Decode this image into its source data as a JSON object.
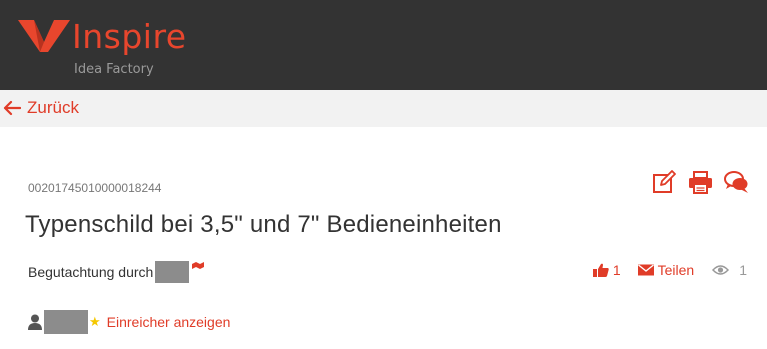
{
  "header": {
    "brand": "Inspire",
    "tagline": "Idea Factory",
    "logo_icon": "v-logo-icon",
    "background": "#333333",
    "accent": "#e8462d"
  },
  "nav": {
    "back_label": "Zurück",
    "back_icon": "arrow-left-icon"
  },
  "idea": {
    "number": "00201745010000018244",
    "title": "Typenschild bei 3,5\" und 7\" Bedieneinheiten",
    "review_label": "Begutachtung durch"
  },
  "toolbar": {
    "icons": [
      "edit-icon",
      "print-icon",
      "comments-icon"
    ]
  },
  "stats": {
    "likes": "1",
    "share_label": "Teilen",
    "views": "1"
  },
  "submitter": {
    "link_label": "Einreicher anzeigen",
    "star": "★"
  },
  "colors": {
    "link_red": "#e03c28",
    "star_yellow": "#f5c800",
    "redaction": "#8c8c8c"
  }
}
